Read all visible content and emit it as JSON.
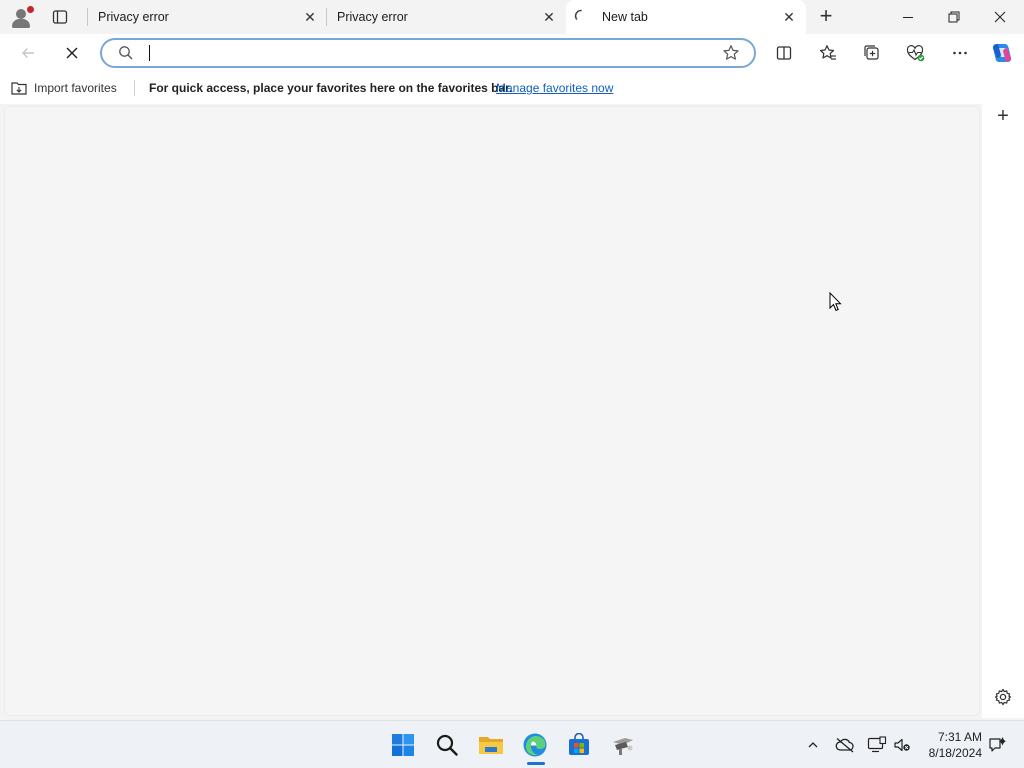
{
  "window": {
    "tabs": [
      {
        "label": "Privacy error",
        "close": "✕"
      },
      {
        "label": "Privacy error",
        "close": "✕"
      },
      {
        "label": "New tab",
        "close": "✕"
      }
    ],
    "new_tab": "+"
  },
  "address_bar": {
    "value": "",
    "placeholder": ""
  },
  "favorites_bar": {
    "import_label": "Import favorites",
    "message": "For quick access, place your favorites here on the favorites bar.",
    "manage_link": "Manage favorites now"
  },
  "sidebar": {
    "add": "+"
  },
  "taskbar": {
    "time": "7:31 AM",
    "date": "8/18/2024"
  },
  "colors": {
    "accent": "#1160c0",
    "address_border": "#7aa7d6",
    "profile_badge": "#c4262e"
  }
}
